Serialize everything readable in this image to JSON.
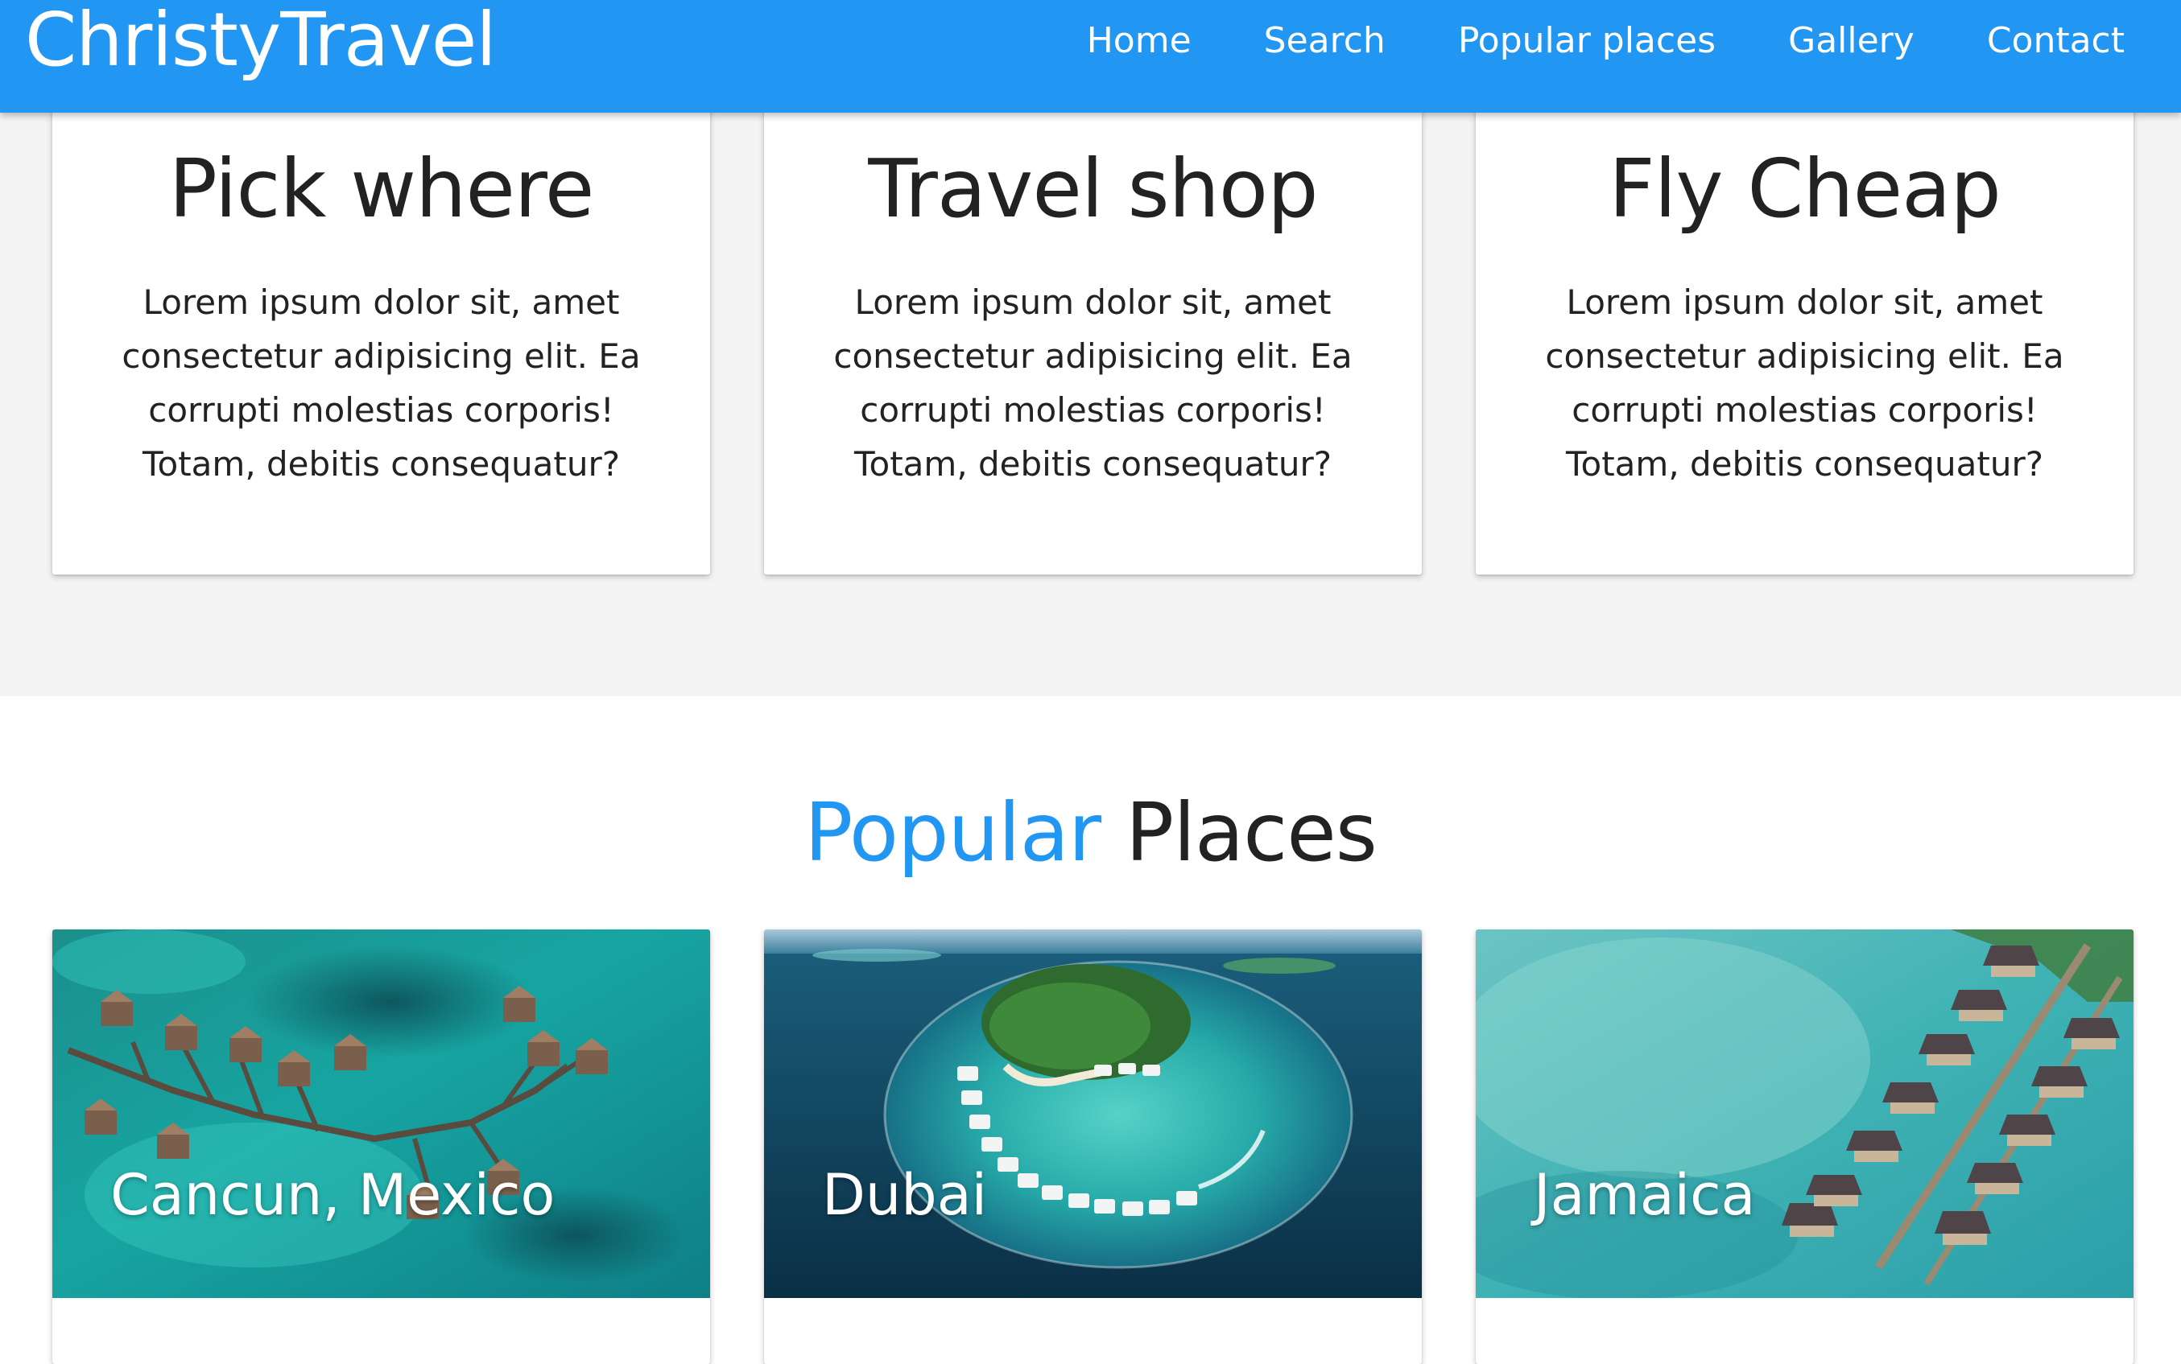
{
  "navbar": {
    "brand": "ChristyTravel",
    "links": [
      {
        "label": "Home"
      },
      {
        "label": "Search"
      },
      {
        "label": "Popular places"
      },
      {
        "label": "Gallery"
      },
      {
        "label": "Contact"
      }
    ]
  },
  "features": [
    {
      "title": "Pick where",
      "text": "Lorem ipsum dolor sit, amet consectetur adipisicing elit. Ea corrupti molestias corporis! Totam, debitis consequatur?"
    },
    {
      "title": "Travel shop",
      "text": "Lorem ipsum dolor sit, amet consectetur adipisicing elit. Ea corrupti molestias corporis! Totam, debitis consequatur?"
    },
    {
      "title": "Fly Cheap",
      "text": "Lorem ipsum dolor sit, amet consectetur adipisicing elit. Ea corrupti molestias corporis! Totam, debitis consequatur?"
    }
  ],
  "popular": {
    "heading_accent": "Popular",
    "heading_rest": "Places",
    "places": [
      {
        "name": "Cancun, Mexico"
      },
      {
        "name": "Dubai"
      },
      {
        "name": "Jamaica"
      }
    ]
  },
  "colors": {
    "primary": "#2196F3",
    "section_bg": "#f4f4f4",
    "text": "#222222"
  }
}
